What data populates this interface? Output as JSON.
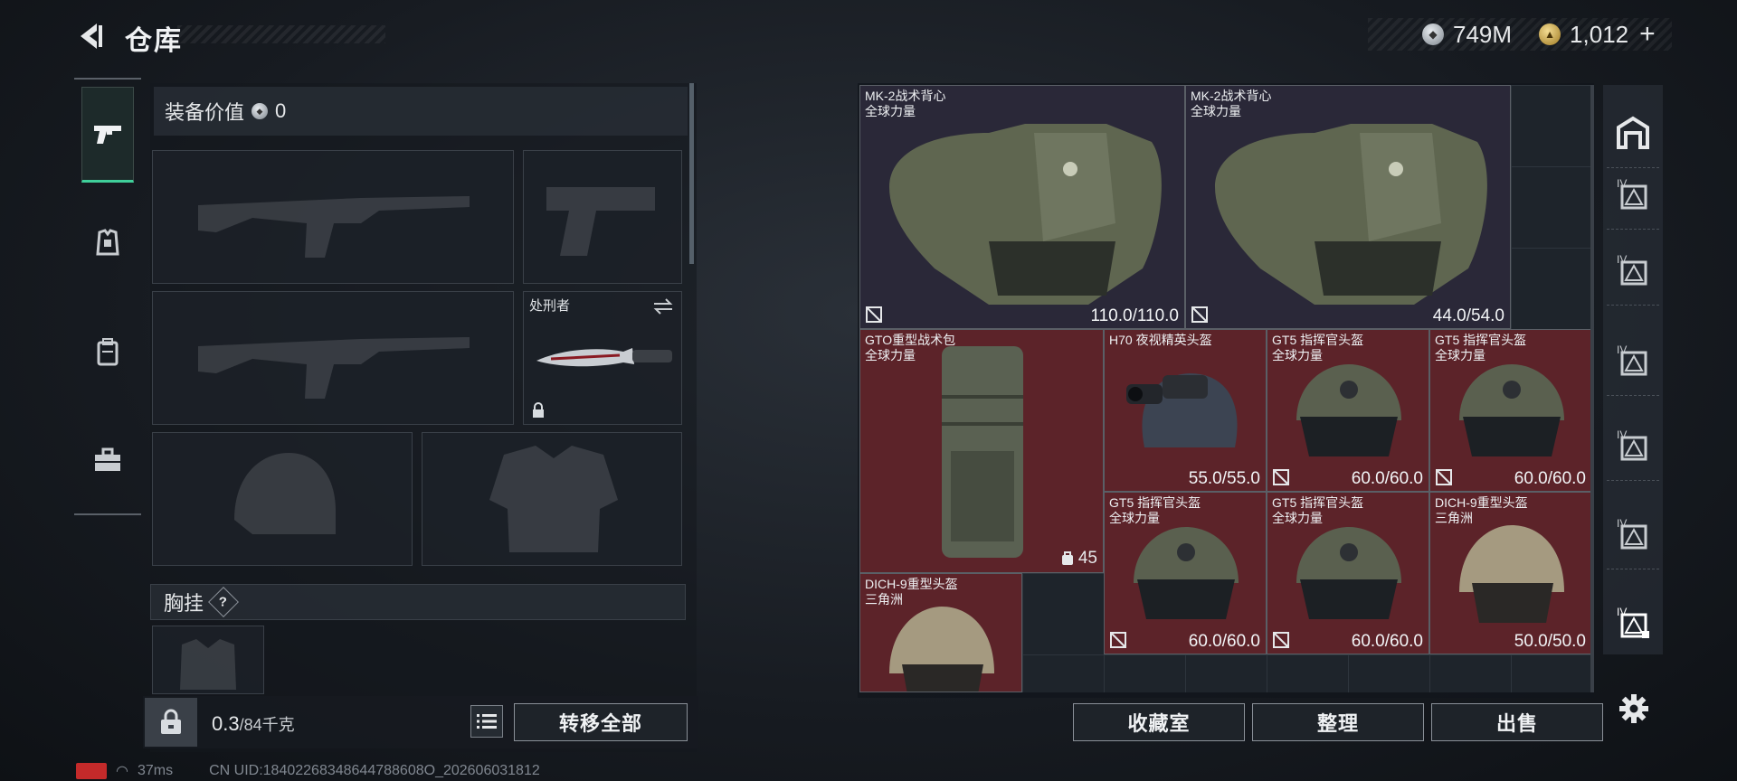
{
  "header": {
    "title": "仓库",
    "currency_silver": "749M",
    "currency_gold": "1,012",
    "plus": "+"
  },
  "loadout": {
    "value_label": "装备价值",
    "value_amount": "0",
    "knife_name": "处刑者",
    "chest_label": "胸挂",
    "help": "?",
    "weight_current": "0.3",
    "weight_max": "/84千克",
    "transfer_all": "转移全部"
  },
  "storage": {
    "items": [
      {
        "name": "MK-2战术背心",
        "sub": "全球力量",
        "durability": "110.0/110.0"
      },
      {
        "name": "MK-2战术背心",
        "sub": "全球力量",
        "durability": "44.0/54.0"
      },
      {
        "name": "GTO重型战术包",
        "sub": "全球力量",
        "count": "45"
      },
      {
        "name": "H70 夜视精英头盔",
        "sub": "",
        "durability": "55.0/55.0"
      },
      {
        "name": "GT5 指挥官头盔",
        "sub": "全球力量",
        "durability": "60.0/60.0"
      },
      {
        "name": "GT5 指挥官头盔",
        "sub": "全球力量",
        "durability": "60.0/60.0"
      },
      {
        "name": "GT5 指挥官头盔",
        "sub": "全球力量",
        "durability": "60.0/60.0"
      },
      {
        "name": "GT5 指挥官头盔",
        "sub": "全球力量",
        "durability": "60.0/60.0"
      },
      {
        "name": "DICH-9重型头盔",
        "sub": "三角洲",
        "durability": "50.0/50.0"
      },
      {
        "name": "DICH-9重型头盔",
        "sub": "三角洲",
        "durability": ""
      }
    ],
    "buttons": {
      "collection": "收藏室",
      "sort": "整理",
      "sell": "出售"
    }
  },
  "status": {
    "ping": "37ms",
    "uid": "CN UID:18402268348644788608O_202606031812"
  },
  "colors": {
    "accent": "#3fcf9a",
    "item_red": "#5c2329",
    "item_vest": "#2a2838",
    "battery": "#c42a2a"
  }
}
